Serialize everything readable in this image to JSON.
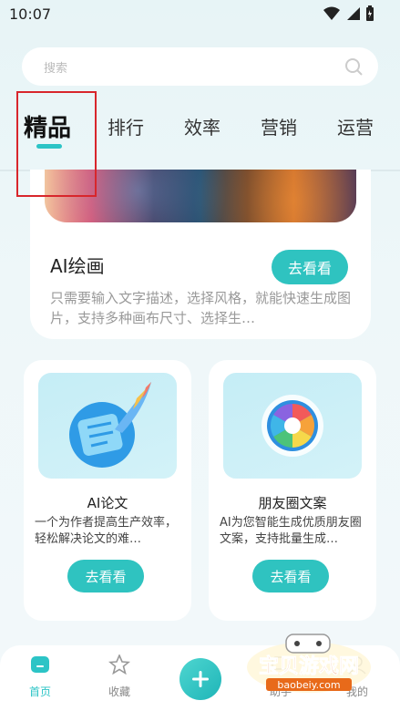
{
  "status": {
    "time": "10:07"
  },
  "search": {
    "placeholder": "搜索"
  },
  "tabs": [
    {
      "label": "精品",
      "active": true
    },
    {
      "label": "排行"
    },
    {
      "label": "效率"
    },
    {
      "label": "营销"
    },
    {
      "label": "运营"
    }
  ],
  "featured": {
    "title": "AI绘画",
    "button": "去看看",
    "description": "只需要输入文字描述，选择风格，就能快速生成图片，支持多种画布尺寸、选择生…"
  },
  "cards": [
    {
      "title": "AI论文",
      "description": "一个为作者提高生产效率，轻松解决论文的难…",
      "button": "去看看",
      "icon": "quill-document-icon"
    },
    {
      "title": "朋友圈文案",
      "description": "AI为您智能生成优质朋友圈文案，支持批量生成…",
      "button": "去看看",
      "icon": "camera-aperture-icon"
    }
  ],
  "nav": {
    "home": "首页",
    "favorites": "收藏",
    "assistant": "助手",
    "mine": "我的"
  },
  "watermark": {
    "text": "宝贝游戏网",
    "url": "baobeiy.com"
  },
  "colors": {
    "accent": "#2fc3c0",
    "highlight_border": "#d8262c"
  }
}
